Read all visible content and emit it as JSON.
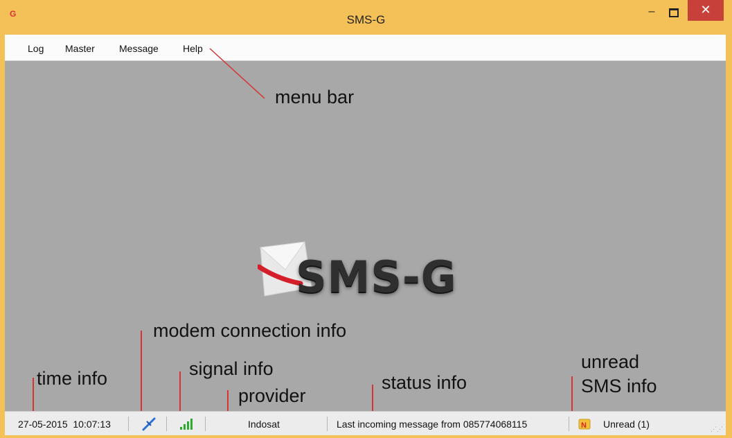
{
  "window": {
    "title": "SMS-G",
    "app_icon": "G",
    "minimize": "–",
    "close": "✕"
  },
  "menu": [
    {
      "label": "Log"
    },
    {
      "label": "Master"
    },
    {
      "label": "Message"
    },
    {
      "label": "Help"
    }
  ],
  "logo": {
    "text": "SMS-G",
    "icon": "envelope-icon"
  },
  "annotations": {
    "menu_bar": "menu bar",
    "modem": "modem connection info",
    "time": "time info",
    "signal": "signal info",
    "provider": "provider",
    "status": "status info",
    "unread_line1": "unread",
    "unread_line2": "SMS info"
  },
  "statusbar": {
    "datetime": "27-05-2015  10:07:13",
    "modem_icon": "plug-icon",
    "signal_icon": "signal-bars-icon",
    "provider": "Indosat",
    "status": "Last incoming message from 085774068115",
    "unread_icon": "new-message-icon",
    "unread": "Unread (1)"
  },
  "colors": {
    "titlebar": "#f4c058",
    "client": "#a8a8a8",
    "close": "#c7413a",
    "annotation_line": "#d63333",
    "signal": "#2eaa2e",
    "modem_icon": "#2a6fd6"
  }
}
